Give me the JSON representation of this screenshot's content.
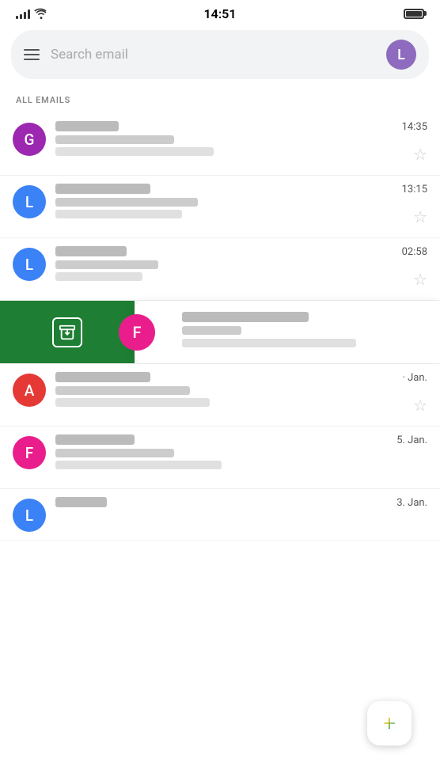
{
  "statusBar": {
    "time": "14:51"
  },
  "searchBar": {
    "placeholder": "Search email",
    "avatarLabel": "L"
  },
  "sectionHeader": "ALL EMAILS",
  "emails": [
    {
      "id": 1,
      "avatarLetter": "G",
      "avatarClass": "avatar-g",
      "time": "14:35",
      "hasDate": false,
      "hasStar": true
    },
    {
      "id": 2,
      "avatarLetter": "L",
      "avatarClass": "avatar-l-blue",
      "time": "13:15",
      "hasDate": false,
      "hasStar": true
    },
    {
      "id": 3,
      "avatarLetter": "L",
      "avatarClass": "avatar-l-blue",
      "time": "02:58",
      "hasDate": false,
      "hasStar": true
    },
    {
      "id": 4,
      "avatarLetter": "F",
      "avatarClass": "avatar-f",
      "time": "",
      "hasDate": false,
      "swiped": true
    },
    {
      "id": 5,
      "avatarLetter": "A",
      "avatarClass": "avatar-a",
      "time": "Jan.",
      "hasDate": true,
      "hasStar": true
    },
    {
      "id": 6,
      "avatarLetter": "F",
      "avatarClass": "avatar-f",
      "time": "5. Jan.",
      "hasDate": false,
      "hasStar": false
    },
    {
      "id": 7,
      "avatarLetter": "L",
      "avatarClass": "avatar-l-blue",
      "time": "3. Jan.",
      "hasDate": false,
      "hasStar": false,
      "partial": true
    }
  ],
  "fab": {
    "label": "+"
  }
}
